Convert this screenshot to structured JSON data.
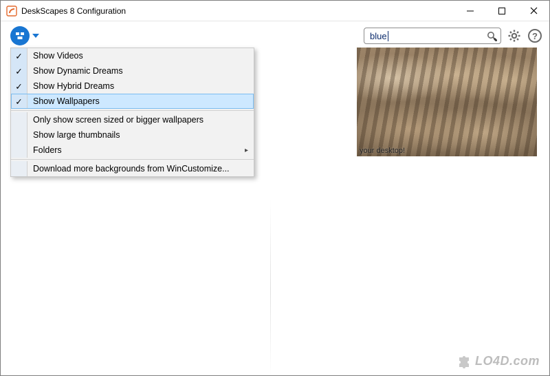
{
  "window": {
    "title": "DeskScapes 8 Configuration"
  },
  "search": {
    "value": "blue",
    "placeholder": ""
  },
  "menu": {
    "items": [
      {
        "label": "Show Videos",
        "checked": true
      },
      {
        "label": "Show Dynamic Dreams",
        "checked": true
      },
      {
        "label": "Show Hybrid Dreams",
        "checked": true
      },
      {
        "label": "Show Wallpapers",
        "checked": true
      }
    ],
    "options": [
      {
        "label": "Only show screen sized or bigger wallpapers"
      },
      {
        "label": "Show large thumbnails"
      },
      {
        "label": "Folders",
        "submenu": true
      },
      {
        "label": "Download more backgrounds from WinCustomize..."
      }
    ],
    "hovered_index": 3
  },
  "preview": {
    "caption": "your desktop!"
  },
  "watermark": {
    "text": "LO4D.com"
  },
  "icons": {
    "app": "deskscapes-icon",
    "minimize": "minimize-icon",
    "maximize": "maximize-icon",
    "close": "close-icon",
    "search": "search-icon",
    "settings": "gear-icon",
    "help": "help-icon",
    "chevron_down": "chevron-down-icon",
    "chevron_right": "chevron-right-icon",
    "check": "check-icon"
  }
}
